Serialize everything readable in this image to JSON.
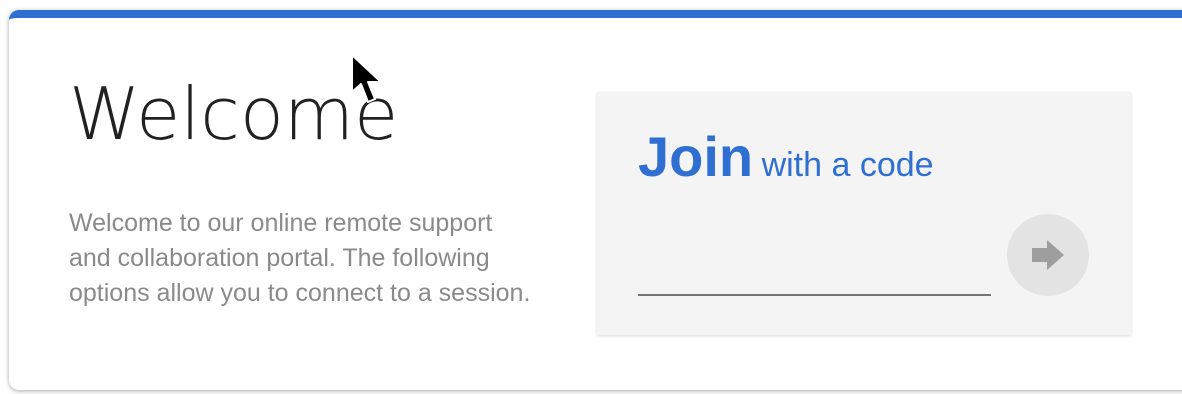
{
  "welcome": {
    "title": "Welcome",
    "description": "Welcome to our online remote support and collaboration portal. The following options allow you to connect to a session."
  },
  "join": {
    "heading_strong": "Join",
    "heading_rest": "with a code",
    "code_value": "",
    "submit_icon": "arrow-right-icon"
  },
  "colors": {
    "accent": "#2f6fd1",
    "panel_background": "#f4f4f4",
    "body_text": "#8a8a8a",
    "title_text": "#212121"
  }
}
